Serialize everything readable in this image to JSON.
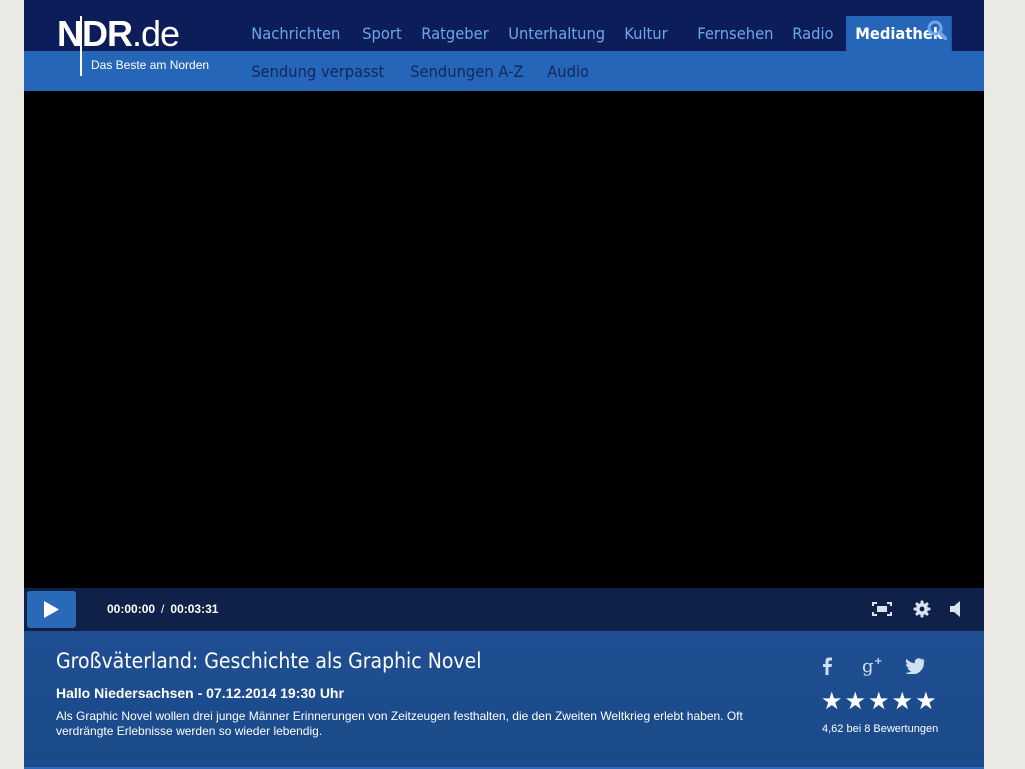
{
  "header": {
    "logo": {
      "brand": "NDR",
      "suffix": ".de",
      "tagline": "Das Beste am Norden"
    },
    "nav": [
      "Nachrichten",
      "Sport",
      "Ratgeber",
      "Unterhaltung",
      "Kultur"
    ],
    "nav_right": [
      "Fernsehen",
      "Radio",
      "Mediathek"
    ],
    "active_nav": "Mediathek",
    "subnav": [
      "Sendung verpasst",
      "Sendungen A-Z",
      "Audio"
    ]
  },
  "player": {
    "current_time": "00:00:00",
    "separator": "/",
    "duration": "00:03:31",
    "icons": [
      "play-icon",
      "fullscreen-icon",
      "gear-icon",
      "volume-icon"
    ]
  },
  "info": {
    "title": "Großväterland: Geschichte als Graphic Novel",
    "meta": "Hallo Niedersachsen - 07.12.2014 19:30 Uhr",
    "description": "Als Graphic Novel wollen drei junge Männer Erinnerungen von Zeitzeugen festhalten, die den Zweiten Weltkrieg erlebt haben. Oft verdrängte Erlebnisse werden so wieder lebendig.",
    "share_icons": [
      "facebook-icon",
      "google-plus-icon",
      "twitter-icon"
    ],
    "rating": {
      "stars_filled": 5,
      "stars_total": 5,
      "text": "4,62 bei 8 Bewertungen"
    }
  },
  "colors": {
    "header_dark": "#0d1d59",
    "header_blue": "#2566b8",
    "nav_link": "#6ea7e8",
    "info_bg": "#1f4f92"
  }
}
